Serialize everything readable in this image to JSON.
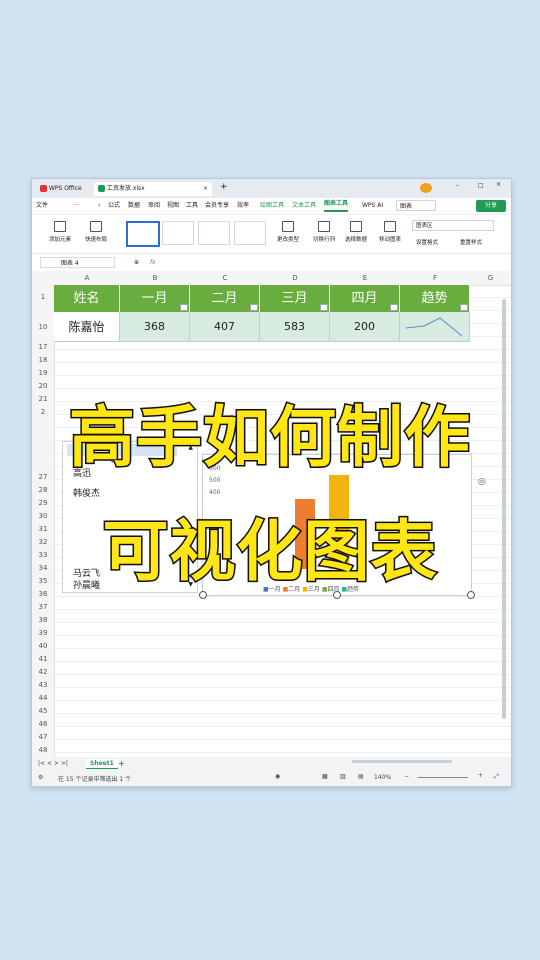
{
  "tabs": {
    "app": "WPS Office",
    "file": "工资发放.xlsx"
  },
  "menu": {
    "file": "文件",
    "more": "···",
    "items": [
      "公式",
      "数据",
      "审阅",
      "视图",
      "工具",
      "会员专享",
      "效率"
    ],
    "ctx": [
      "绘图工具",
      "文本工具",
      "图表工具"
    ],
    "ai": "WPS AI",
    "search": "图表",
    "share": "分享"
  },
  "ribbon": {
    "add": "添加元素",
    "layout": "快速布局",
    "change_type": "更改类型",
    "switch": "切换行列",
    "select_data": "选择数据",
    "move": "移动图表",
    "area": "图表区",
    "format": "设置格式",
    "reset": "重置样式"
  },
  "formula": {
    "name": "图表 4",
    "fx": "fx"
  },
  "columns": [
    "A",
    "B",
    "C",
    "D",
    "E",
    "F",
    "G"
  ],
  "rows": [
    "1",
    "10",
    "17",
    "18",
    "19",
    "20",
    "21",
    "2",
    "27",
    "28",
    "29",
    "30",
    "31",
    "32",
    "33",
    "34",
    "35",
    "36",
    "37",
    "38",
    "39",
    "40",
    "41",
    "42",
    "43",
    "44",
    "45",
    "46",
    "47",
    "48"
  ],
  "table": {
    "headers": [
      "姓名",
      "一月",
      "二月",
      "三月",
      "四月",
      "趋势"
    ],
    "row": [
      "陈嘉怡",
      "368",
      "407",
      "583",
      "200"
    ]
  },
  "list": [
    "高迅",
    "韩俊杰",
    "孙晨曦"
  ],
  "list_partial": [
    "马云飞"
  ],
  "chart_data": {
    "type": "bar",
    "y_ticks": [
      "600",
      "500",
      "400"
    ],
    "legend": [
      "一月",
      "二月",
      "三月",
      "四月",
      "趋势"
    ],
    "colors": [
      "#4472c4",
      "#ed7d31",
      "#a5a5a5",
      "#ffc000",
      "#5b9bd5"
    ]
  },
  "status": {
    "sheet": "Sheet1",
    "info": "在 15 个记录中筛选出 1 个",
    "zoom": "140%"
  },
  "overlay": {
    "line1": "高手如何制作",
    "line2": "可视化图表"
  }
}
